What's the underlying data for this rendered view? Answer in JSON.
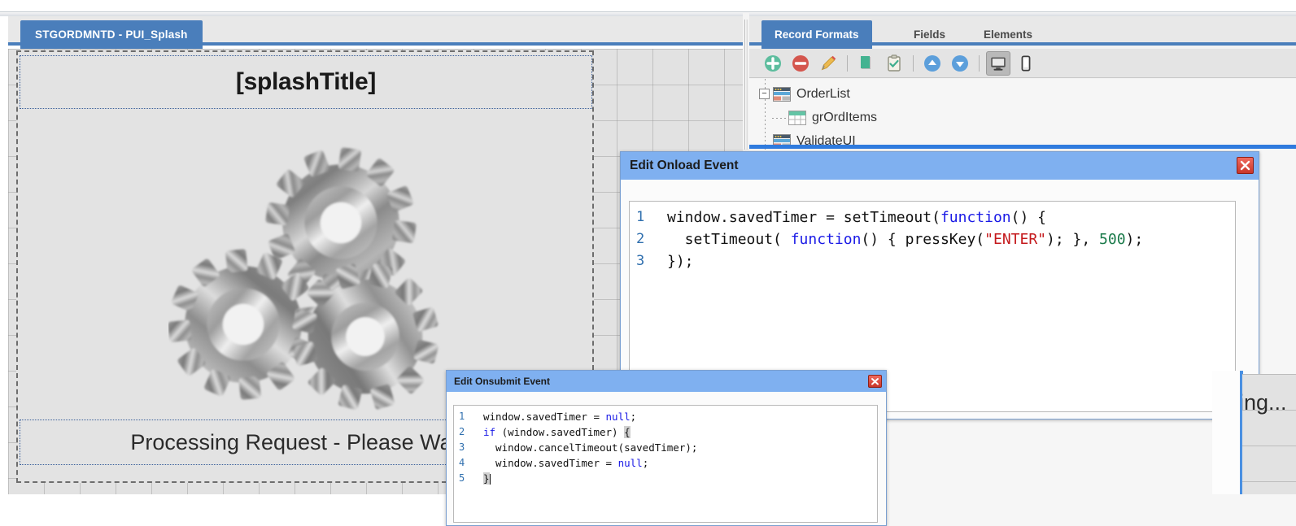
{
  "left_panel": {
    "tab_label": "STGORDMNTD - PUI_Splash",
    "design": {
      "splash_title": "[splashTitle]",
      "status_text": "Processing Request - Please Wait...",
      "gears_icon": "three-gears-icon"
    }
  },
  "right_panel": {
    "tabs": [
      {
        "label": "Record Formats",
        "active": true
      },
      {
        "label": "Fields",
        "active": false
      },
      {
        "label": "Elements",
        "active": false
      }
    ],
    "toolbar": [
      {
        "name": "add-icon",
        "glyph": "+",
        "color": "#3fae8e",
        "title": "Add"
      },
      {
        "name": "remove-icon",
        "glyph": "–",
        "color": "#cf4a42",
        "title": "Remove"
      },
      {
        "name": "edit-pencil-icon",
        "glyph": "✎",
        "color": "#e8a93b",
        "title": "Edit"
      },
      {
        "name": "separator-1",
        "glyph": "",
        "color": "",
        "title": ""
      },
      {
        "name": "green-page-icon",
        "glyph": "",
        "color": "#44b391",
        "title": "New Format"
      },
      {
        "name": "clipboard-check-icon",
        "glyph": "✓",
        "color": "#3fae8e",
        "title": "Validate"
      },
      {
        "name": "separator-2",
        "glyph": "",
        "color": "",
        "title": ""
      },
      {
        "name": "move-up-icon",
        "glyph": "▲",
        "color": "#3d8fd6",
        "title": "Move Up"
      },
      {
        "name": "move-down-icon",
        "glyph": "▼",
        "color": "#3d8fd6",
        "title": "Move Down"
      },
      {
        "name": "separator-3",
        "glyph": "",
        "color": "",
        "title": ""
      },
      {
        "name": "desktop-view-icon",
        "glyph": "",
        "color": "#3b3b3b",
        "title": "Desktop View"
      },
      {
        "name": "mobile-view-icon",
        "glyph": "",
        "color": "#3b3b3b",
        "title": "Mobile View"
      }
    ],
    "tree": [
      {
        "label": "OrderList",
        "icon": "record-format-icon",
        "indent": 0,
        "expander": "−"
      },
      {
        "label": "grOrdItems",
        "icon": "grid-icon",
        "indent": 1,
        "expander": ""
      },
      {
        "label": "ValidateUI",
        "icon": "record-format-icon",
        "indent": 0,
        "expander": ""
      }
    ]
  },
  "dialogs": [
    {
      "id": "onload",
      "title": "Edit Onload Event",
      "close_label": "✖",
      "lines": [
        "1",
        "2",
        "3"
      ],
      "code": [
        "window.savedTimer = setTimeout(function() {",
        "  setTimeout( function() { pressKey(\"ENTER\"); }, 500);",
        "});"
      ]
    },
    {
      "id": "onsubmit",
      "title": "Edit Onsubmit Event",
      "close_label": "✖",
      "lines": [
        "1",
        "2",
        "3",
        "4",
        "5"
      ],
      "code": [
        "window.savedTimer = null;",
        "if (window.savedTimer) {",
        "  window.cancelTimeout(savedTimer);",
        "  window.savedTimer = null;",
        "}"
      ]
    }
  ],
  "clipped_right": {
    "partial_text": "ing..."
  },
  "colors": {
    "accent_blue": "#4a7ebb",
    "dialog_title_blue": "#7fb0f0",
    "band_blue": "#2f7bde",
    "canvas_gray": "#e2e2e2",
    "close_red": "#c9362a"
  }
}
